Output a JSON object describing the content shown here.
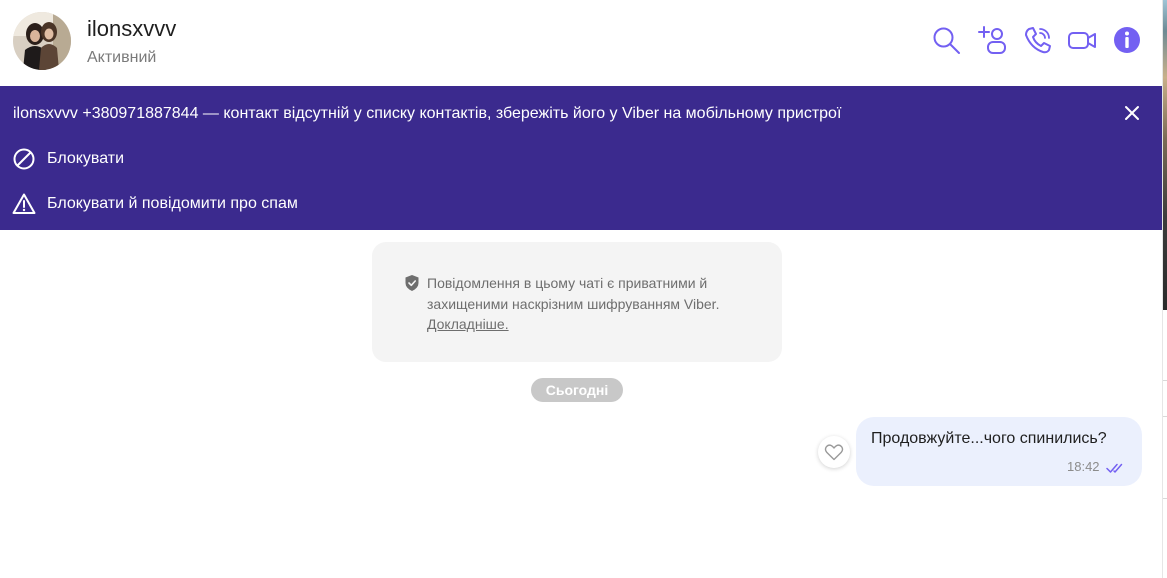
{
  "header": {
    "contact_name": "ilonsxvvv",
    "status": "Активний",
    "icons": [
      "search-icon",
      "add-participant-icon",
      "voice-call-icon",
      "video-call-icon",
      "info-icon"
    ]
  },
  "banner": {
    "text": "ilonsxvvv +380971887844 — контакт відсутній у списку контактів, збережіть його у Viber на мобільному пристрої",
    "block_label": "Блокувати",
    "block_spam_label": "Блокувати й повідомити про спам"
  },
  "encryption": {
    "text": "Повідомлення в цьому чаті є приватними й захищеними наскрізним шифруванням Viber.",
    "link": "Докладніше."
  },
  "date_separator": "Сьогодні",
  "messages": [
    {
      "text": "Продовжуйте...чого спинились?",
      "time": "18:42",
      "status": "read"
    }
  ],
  "colors": {
    "accent": "#7360f2",
    "banner_bg": "#3b2a8e",
    "bubble_bg": "#ebf0fd"
  }
}
